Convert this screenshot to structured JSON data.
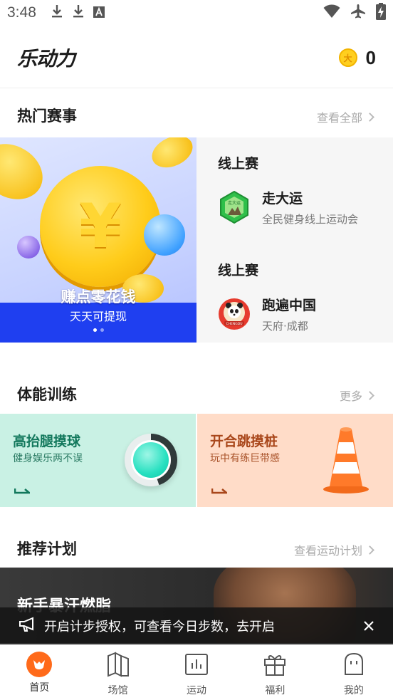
{
  "status_bar": {
    "time": "3:48",
    "left_icons": [
      "download-icon",
      "download-icon",
      "font-icon"
    ],
    "right_icons": [
      "wifi-icon",
      "airplane-icon",
      "battery-charging-icon"
    ]
  },
  "header": {
    "logo": "乐动力",
    "coin_count": "0",
    "coin_icon_text": "大"
  },
  "hot_events": {
    "title": "热门赛事",
    "more": "查看全部",
    "banner": {
      "title": "赚点零花钱",
      "subtitle": "天天可提现",
      "slides": 2,
      "active_slide": 0
    },
    "events": [
      {
        "type": "线上赛",
        "name": "走大运",
        "desc": "全民健身线上运动会",
        "badge_text": "走大运"
      },
      {
        "type": "线上赛",
        "name": "跑遍中国",
        "desc": "天府·成都",
        "badge_text": "CHENGDU"
      }
    ]
  },
  "training": {
    "title": "体能训练",
    "more": "更多",
    "cards": [
      {
        "title": "高抬腿摸球",
        "subtitle": "健身娱乐两不误"
      },
      {
        "title": "开合跳摸桩",
        "subtitle": "玩中有练巨带感"
      }
    ]
  },
  "plans": {
    "title": "推荐计划",
    "more": "查看运动计划",
    "card_title": "新手暴汗燃脂"
  },
  "toast": {
    "text": "开启计步授权，可查看今日步数，去开启"
  },
  "bottom_nav": {
    "items": [
      {
        "label": "首页",
        "icon": "home-icon",
        "active": true
      },
      {
        "label": "场馆",
        "icon": "map-icon",
        "active": false
      },
      {
        "label": "运动",
        "icon": "chart-icon",
        "active": false
      },
      {
        "label": "福利",
        "icon": "gift-icon",
        "active": false
      },
      {
        "label": "我的",
        "icon": "profile-icon",
        "active": false
      }
    ]
  },
  "colors": {
    "accent": "#ff6a1a",
    "banner_blue": "#1f3ff0",
    "train_left_bg": "#c9f1e4",
    "train_right_bg": "#ffdcc8"
  }
}
